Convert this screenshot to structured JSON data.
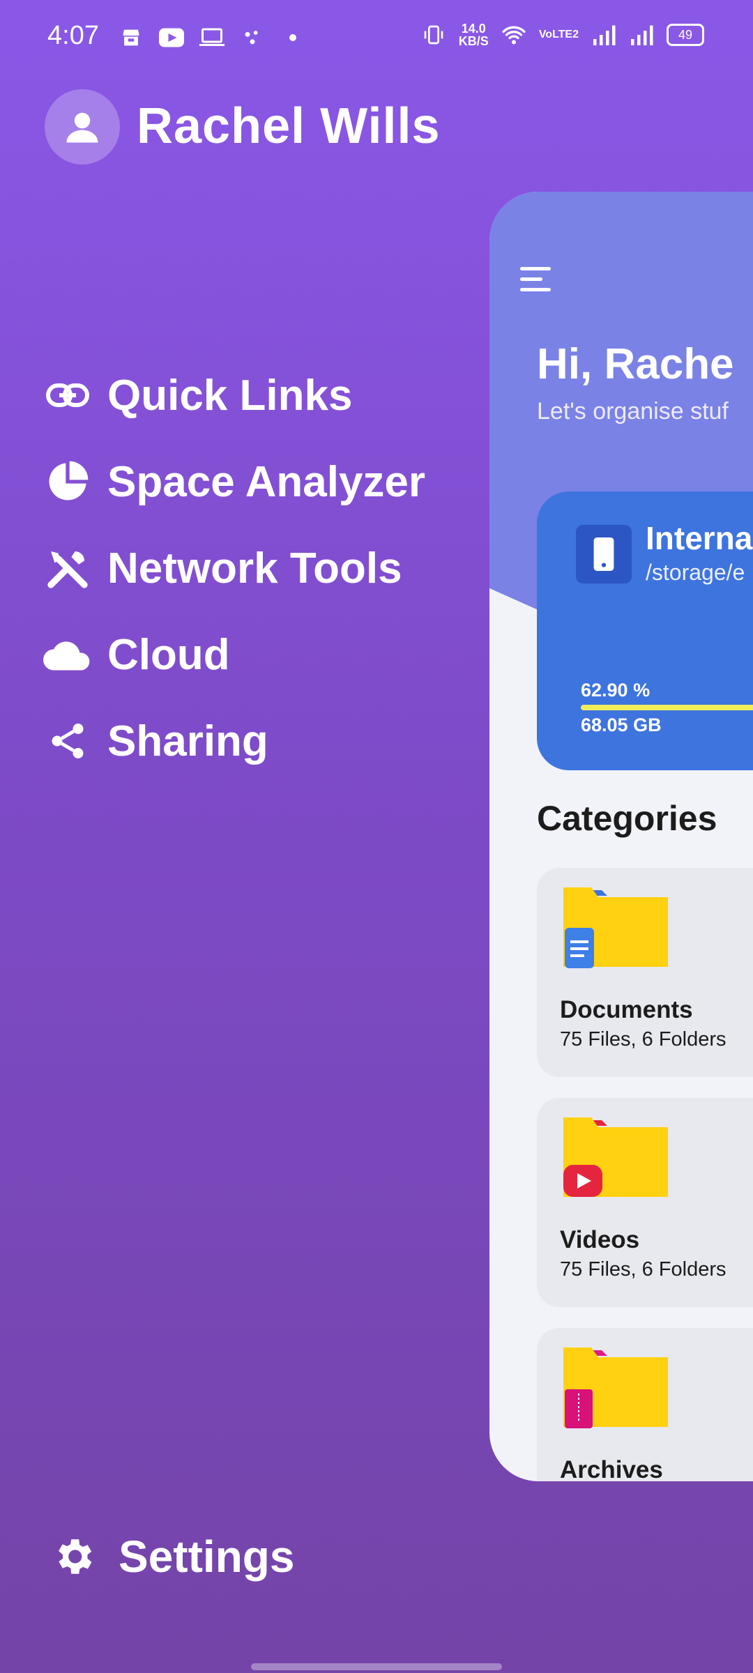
{
  "status_bar": {
    "time": "4:07",
    "net_speed_value": "14.0",
    "net_speed_unit": "KB/S",
    "volte": "VoLTE2",
    "battery": "49"
  },
  "profile": {
    "name": "Rachel Wills"
  },
  "menu": {
    "items": [
      {
        "label": "Quick Links",
        "icon": "link-icon"
      },
      {
        "label": "Space Analyzer",
        "icon": "pie-chart-icon"
      },
      {
        "label": "Network Tools",
        "icon": "tools-icon"
      },
      {
        "label": "Cloud",
        "icon": "cloud-icon"
      },
      {
        "label": "Sharing",
        "icon": "share-icon"
      }
    ],
    "settings_label": "Settings"
  },
  "preview": {
    "greeting": "Hi, Rache",
    "subgreeting": "Let's organise stuf",
    "storage": {
      "title": "Interna",
      "path": "/storage/e",
      "used_percent": "62.90 %",
      "used_size": "68.05 GB"
    },
    "categories_title": "Categories",
    "categories": [
      {
        "name": "Documents",
        "meta": "75 Files, 6 Folders"
      },
      {
        "name": "Videos",
        "meta": "75 Files, 6 Folders"
      },
      {
        "name": "Archives",
        "meta": ""
      }
    ]
  },
  "colors": {
    "drawer_bg": "#8A58E7",
    "preview_header": "#7A82E6",
    "storage_card": "#3E74DE",
    "progress": "#F1EE5A",
    "folder_yellow": "#FFD110"
  }
}
